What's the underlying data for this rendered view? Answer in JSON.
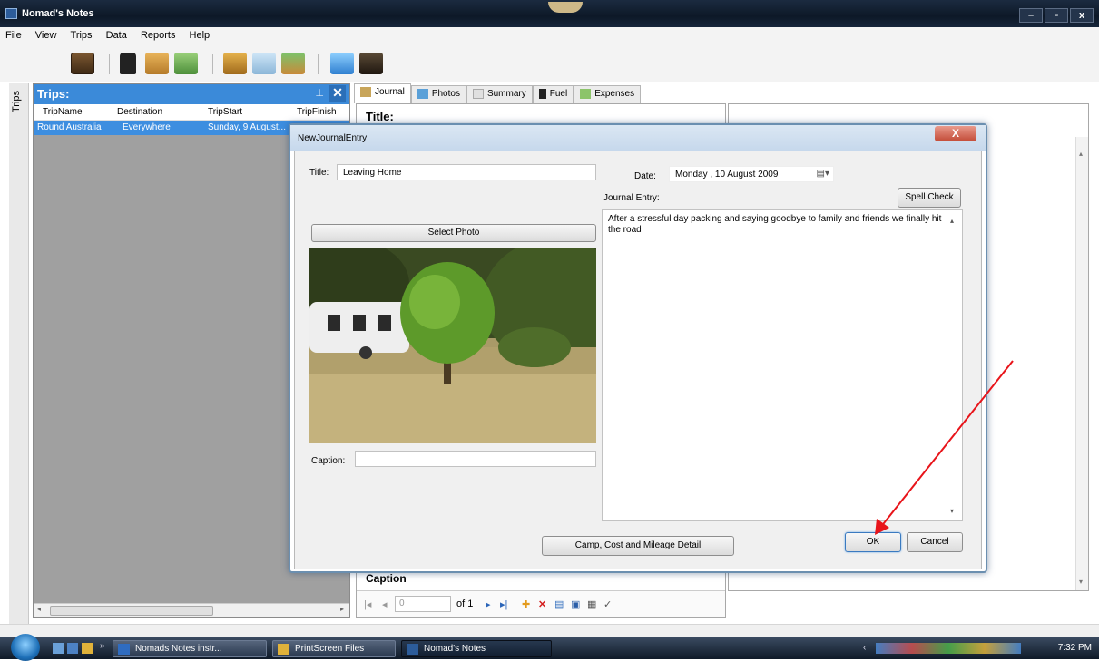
{
  "window": {
    "title": "Nomad's Notes"
  },
  "menu": [
    "File",
    "View",
    "Trips",
    "Data",
    "Reports",
    "Help"
  ],
  "trips_panel": {
    "vertical_tab": "Trips",
    "header": "Trips:",
    "columns": [
      "TripName",
      "Destination",
      "TripStart",
      "TripFinish"
    ],
    "rows": [
      {
        "name": "Round Australia",
        "destination": "Everywhere",
        "start": "Sunday, 9 August..."
      }
    ]
  },
  "tabs": [
    "Journal",
    "Photos",
    "Summary",
    "Fuel",
    "Expenses"
  ],
  "journal_view": {
    "title_label": "Title:",
    "caption_label": "Caption",
    "nav": {
      "position": "0",
      "of": "of 1"
    }
  },
  "dialog": {
    "title": "NewJournalEntry",
    "title_label": "Title:",
    "title_value": "Leaving Home",
    "date_label": "Date:",
    "date_value": "Monday , 10  August  2009",
    "journal_label": "Journal Entry:",
    "spell_check": "Spell Check",
    "select_photo": "Select Photo",
    "entry_text": "After a stressful day packing and saying goodbye to family and friends we finally hit the road",
    "caption_label": "Caption:",
    "caption_value": "",
    "detail_button": "Camp, Cost and Mileage Detail",
    "ok": "OK",
    "cancel": "Cancel",
    "close": "X"
  },
  "taskbar": {
    "items": [
      "Nomads Notes instr...",
      "PrintScreen Files",
      "Nomad's Notes"
    ],
    "clock": "7:32 PM"
  },
  "colors": {
    "selection": "#3d8ee0",
    "annotation_arrow": "#e8141a"
  }
}
